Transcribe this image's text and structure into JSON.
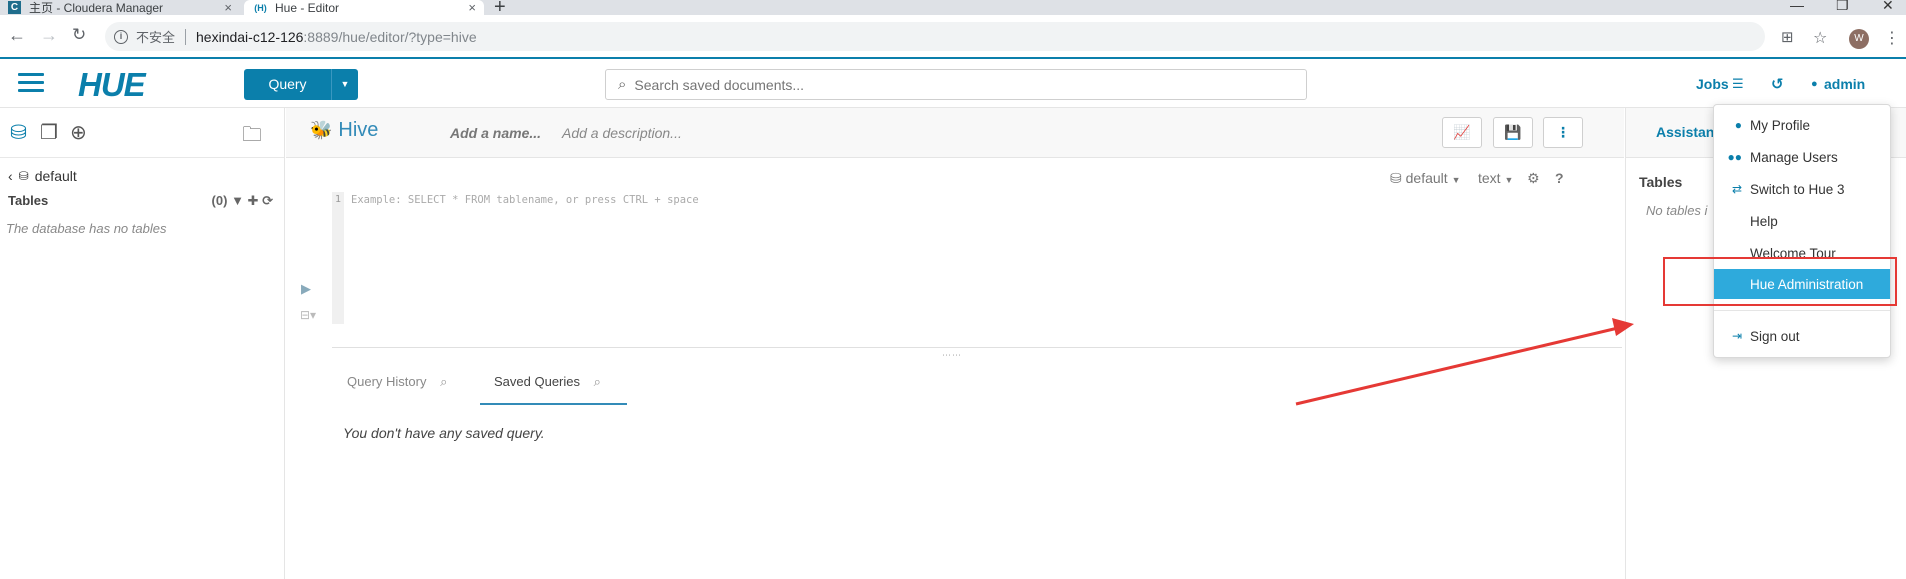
{
  "browser": {
    "tabs": [
      {
        "label": "主页 - Cloudera Manager",
        "favicon": "C"
      },
      {
        "label": "Hue - Editor",
        "favicon": "(H)"
      }
    ],
    "close_glyph": "×",
    "new_tab_glyph": "+",
    "address": {
      "security_label": "不安全",
      "host": "hexindai-c12-126",
      "rest": ":8889/hue/editor/?type=hive"
    },
    "profile_initial": "W"
  },
  "hue_nav": {
    "logo": "HUE",
    "query_button": "Query",
    "search_placeholder": "Search saved documents...",
    "jobs": "Jobs",
    "user": "admin"
  },
  "left_panel": {
    "database": "default",
    "tables_header": "Tables",
    "tables_count": "(0)",
    "empty_text": "The database has no tables"
  },
  "editor": {
    "type": "Hive",
    "name_placeholder": "Add a name...",
    "description_placeholder": "Add a description...",
    "database_select": "default",
    "format_select": "text",
    "line_number": "1",
    "code_placeholder": "Example: SELECT * FROM tablename, or press CTRL + space"
  },
  "results": {
    "tabs": [
      {
        "label": "Query History",
        "active": false
      },
      {
        "label": "Saved Queries",
        "active": true
      }
    ],
    "empty_text": "You don't have any saved query."
  },
  "right_panel": {
    "title": "Assistant",
    "tables_header": "Tables",
    "empty_text": "No tables i"
  },
  "user_menu": {
    "items": [
      {
        "label": "My Profile",
        "icon": "user-icon"
      },
      {
        "label": "Manage Users",
        "icon": "users-icon"
      },
      {
        "label": "Switch to Hue 3",
        "icon": "exchange-icon"
      },
      {
        "label": "Help",
        "icon": ""
      },
      {
        "label": "Welcome Tour",
        "icon": ""
      },
      {
        "label": "Hue Administration",
        "icon": "",
        "highlighted": true
      },
      {
        "label": "Sign out",
        "icon": "sign-out-icon"
      }
    ]
  },
  "colors": {
    "hue_blue": "#0b7fab",
    "menu_highlight": "#2eaadc",
    "annotation_red": "#e53935"
  }
}
